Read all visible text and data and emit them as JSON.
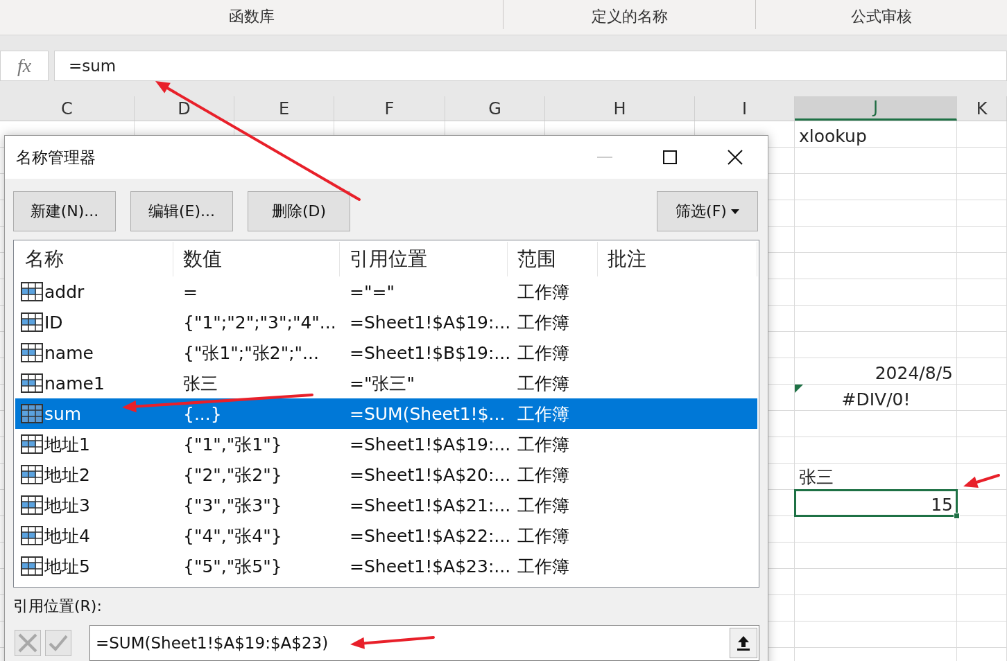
{
  "ribbon": {
    "groups": [
      {
        "label": "函数库"
      },
      {
        "label": "定义的名称"
      },
      {
        "label": "公式审核"
      }
    ]
  },
  "formula_bar": {
    "fx": "fx",
    "value": "=sum"
  },
  "sheet": {
    "columns": [
      {
        "label": "C",
        "selected": false
      },
      {
        "label": "D",
        "selected": false
      },
      {
        "label": "E",
        "selected": false
      },
      {
        "label": "F",
        "selected": false
      },
      {
        "label": "G",
        "selected": false
      },
      {
        "label": "H",
        "selected": false
      },
      {
        "label": "I",
        "selected": false
      },
      {
        "label": "J",
        "selected": true
      },
      {
        "label": "K",
        "selected": false
      }
    ],
    "rows": [
      {
        "cells": [
          {},
          {},
          {},
          {},
          {},
          {},
          {},
          {
            "text": "xlookup",
            "kind": "text"
          },
          {}
        ]
      },
      {},
      {},
      {},
      {},
      {},
      {},
      {},
      {},
      {
        "cells": [
          {},
          {},
          {},
          {},
          {},
          {},
          {},
          {
            "text": "2024/8/5",
            "kind": "number"
          },
          {}
        ]
      },
      {
        "cells": [
          {},
          {},
          {},
          {},
          {},
          {},
          {},
          {
            "text": "#DIV/0!",
            "kind": "error"
          },
          {}
        ]
      },
      {},
      {},
      {
        "cells": [
          {},
          {},
          {},
          {},
          {},
          {},
          {},
          {
            "text": "张三",
            "kind": "text"
          },
          {}
        ]
      },
      {
        "cells": [
          {},
          {},
          {},
          {},
          {},
          {},
          {},
          {
            "text": "15",
            "kind": "number",
            "selected": true
          },
          {}
        ]
      },
      {},
      {},
      {},
      {},
      {},
      {}
    ]
  },
  "dialog": {
    "title": "名称管理器",
    "buttons": [
      {
        "label": "新建(N)..."
      },
      {
        "label": "编辑(E)..."
      },
      {
        "label": "删除(D)"
      }
    ],
    "filter_button": {
      "label": "筛选(F)"
    },
    "table": {
      "columns": [
        "名称",
        "数值",
        "引用位置",
        "范围",
        "批注"
      ],
      "rows": [
        {
          "name": "addr",
          "value": "=",
          "refers_to": "=\"=\"",
          "scope": "工作簿",
          "selected": false
        },
        {
          "name": "ID",
          "value": "{\"1\";\"2\";\"3\";\"4\"...",
          "refers_to": "=Sheet1!$A$19:...",
          "scope": "工作簿",
          "selected": false
        },
        {
          "name": "name",
          "value": "{\"张1\";\"张2\";\"...",
          "refers_to": "=Sheet1!$B$19:...",
          "scope": "工作簿",
          "selected": false
        },
        {
          "name": "name1",
          "value": "张三",
          "refers_to": "=\"张三\"",
          "scope": "工作簿",
          "selected": false
        },
        {
          "name": "sum",
          "value": "{...}",
          "refers_to": "=SUM(Sheet1!$...",
          "scope": "工作簿",
          "selected": true
        },
        {
          "name": "地址1",
          "value": "{\"1\",\"张1\"}",
          "refers_to": "=Sheet1!$A$19:...",
          "scope": "工作簿",
          "selected": false
        },
        {
          "name": "地址2",
          "value": "{\"2\",\"张2\"}",
          "refers_to": "=Sheet1!$A$20:...",
          "scope": "工作簿",
          "selected": false
        },
        {
          "name": "地址3",
          "value": "{\"3\",\"张3\"}",
          "refers_to": "=Sheet1!$A$21:...",
          "scope": "工作簿",
          "selected": false
        },
        {
          "name": "地址4",
          "value": "{\"4\",\"张4\"}",
          "refers_to": "=Sheet1!$A$22:...",
          "scope": "工作簿",
          "selected": false
        },
        {
          "name": "地址5",
          "value": "{\"5\",\"张5\"}",
          "refers_to": "=Sheet1!$A$23:...",
          "scope": "工作簿",
          "selected": false
        }
      ]
    },
    "refers_to_label": "引用位置(R):",
    "refers_to_value": "=SUM(Sheet1!$A$19:$A$23)",
    "edit_buttons_disabled": true
  }
}
